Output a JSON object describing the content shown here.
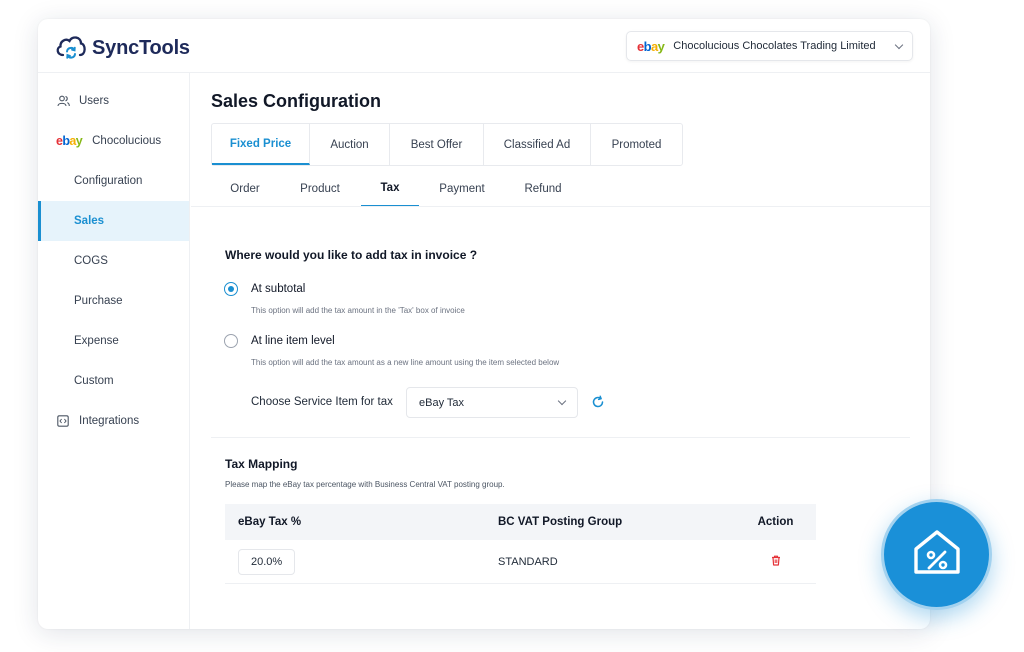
{
  "app": {
    "name": "SyncTools",
    "store_brand": "ebay",
    "store_name": "Chocolucious Chocolates Trading Limited"
  },
  "sidebar": {
    "items": [
      {
        "label": "Users",
        "icon": "users-icon",
        "level": "top",
        "active": false
      },
      {
        "label": "Chocolucious",
        "icon": "ebay-logo",
        "level": "top",
        "active": false
      },
      {
        "label": "Configuration",
        "level": "sub",
        "active": false
      },
      {
        "label": "Sales",
        "level": "sub",
        "active": true
      },
      {
        "label": "COGS",
        "level": "sub",
        "active": false
      },
      {
        "label": "Purchase",
        "level": "sub",
        "active": false
      },
      {
        "label": "Expense",
        "level": "sub",
        "active": false
      },
      {
        "label": "Custom",
        "level": "sub",
        "active": false
      },
      {
        "label": "Integrations",
        "icon": "integrations-icon",
        "level": "top",
        "active": false
      }
    ]
  },
  "main": {
    "title": "Sales Configuration",
    "listing_tabs": [
      {
        "label": "Fixed Price",
        "active": true
      },
      {
        "label": "Auction",
        "active": false
      },
      {
        "label": "Best Offer",
        "active": false
      },
      {
        "label": "Classified Ad",
        "active": false
      },
      {
        "label": "Promoted",
        "active": false
      }
    ],
    "section_tabs": [
      {
        "label": "Order",
        "active": false
      },
      {
        "label": "Product",
        "active": false
      },
      {
        "label": "Tax",
        "active": true
      },
      {
        "label": "Payment",
        "active": false
      },
      {
        "label": "Refund",
        "active": false
      }
    ],
    "tax": {
      "question": "Where would you like to add tax in invoice ?",
      "options": [
        {
          "label": "At subtotal",
          "description": "This option will add the tax amount in the 'Tax' box of invoice",
          "selected": true
        },
        {
          "label": "At line item level",
          "description": "This option will add the tax amount as a new line amount using the item selected below",
          "selected": false
        }
      ],
      "service_item_label": "Choose Service Item for tax",
      "service_item_value": "eBay Tax"
    },
    "mapping": {
      "title": "Tax Mapping",
      "description": "Please map the eBay tax percentage with Business Central VAT posting group.",
      "columns": [
        "eBay Tax %",
        "BC VAT Posting Group",
        "Action"
      ],
      "rows": [
        {
          "tax": "20.0%",
          "group": "STANDARD",
          "action": "delete-icon"
        }
      ]
    }
  },
  "colors": {
    "accent": "#1a8fd1",
    "navy": "#1e2a5a",
    "danger": "#e53238"
  },
  "badge_icon": "house-percent-icon"
}
